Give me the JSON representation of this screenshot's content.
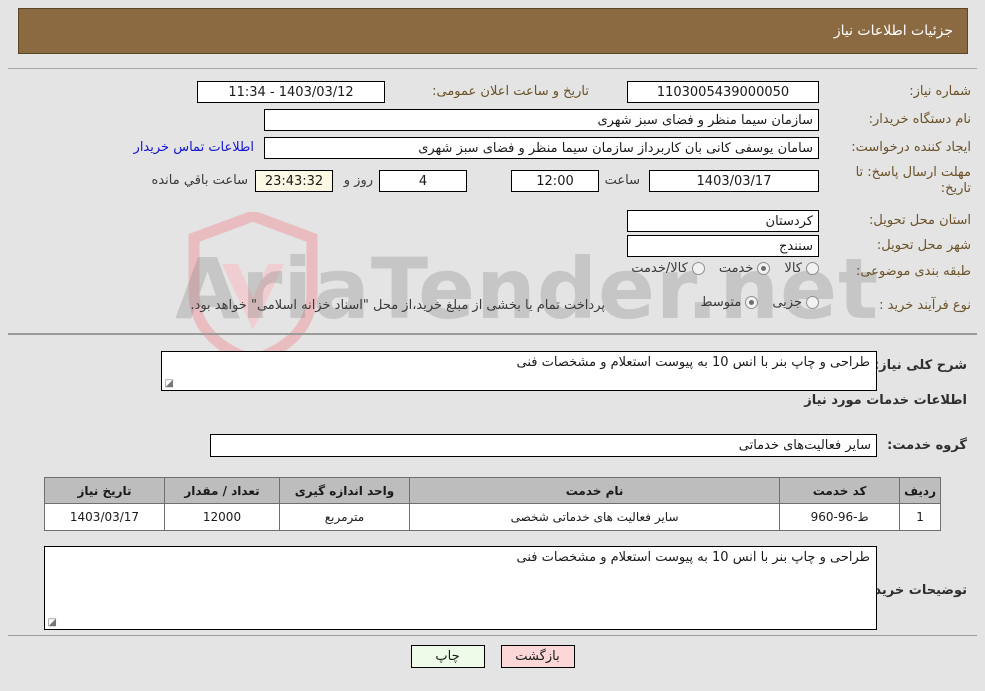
{
  "header": {
    "title": "جزئیات اطلاعات نیاز"
  },
  "watermark": {
    "text": "AriaTender.net",
    "shield_color": "#e8b7bb"
  },
  "form": {
    "need_number_label": "شماره نیاز:",
    "need_number_value": "1103005439000050",
    "announce_datetime_label": "تاریخ و ساعت اعلان عمومی:",
    "announce_datetime_value": "1403/03/12 - 11:34",
    "buyer_org_label": "نام دستگاه خریدار:",
    "buyer_org_value": "سازمان سیما  منظر و فضای سبز شهری",
    "requester_label": "ایجاد کننده درخواست:",
    "requester_value": "سامان یوسفی کانی بان کاربرداز سازمان سیما  منظر و فضای سبز شهری",
    "contact_link": "اطلاعات تماس خریدار",
    "deadline_label": "مهلت ارسال پاسخ: تا تاریخ:",
    "deadline_date": "1403/03/17",
    "deadline_hour_label": "ساعت",
    "deadline_hour_value": "12:00",
    "remaining_days": "4",
    "remaining_days_label": "روز و",
    "remaining_time": "23:43:32",
    "remaining_time_label": "ساعت باقي مانده",
    "province_label": "استان محل تحویل:",
    "province_value": "کردستان",
    "city_label": "شهر محل تحویل:",
    "city_value": "سنندج",
    "classification_label": "طبقه بندی موضوعی:",
    "classification_options": [
      {
        "label": "کالا",
        "selected": false
      },
      {
        "label": "خدمت",
        "selected": true
      },
      {
        "label": "کالا/خدمت",
        "selected": false
      }
    ],
    "process_label": "نوع فرآیند خرید :",
    "process_options": [
      {
        "label": "جزیی",
        "selected": false
      },
      {
        "label": "متوسط",
        "selected": true
      }
    ],
    "treasury_note": "پرداخت تمام یا بخشی از مبلغ خرید،از محل \"اسناد خزانه اسلامی\" خواهد بود."
  },
  "body": {
    "summary_label": "شرح کلی نیاز:",
    "summary_value": "طراحی و چاپ بنر با انس 10 به پیوست استعلام و مشخصات فنی",
    "services_section_title": "اطلاعات خدمات مورد نیاز",
    "service_group_label": "گروه خدمت:",
    "service_group_value": "سایر فعالیت‌های خدماتی",
    "buyer_notes_label": "توضیحات خریدار:",
    "buyer_notes_value": "طراحی و چاپ بنر با انس 10 به پیوست استعلام و مشخصات فنی"
  },
  "table": {
    "columns": [
      "ردیف",
      "کد خدمت",
      "نام خدمت",
      "واحد اندازه گیری",
      "تعداد / مقدار",
      "تاریخ نیاز"
    ],
    "rows": [
      {
        "row_no": "1",
        "service_code": "ط-96-960",
        "service_name": "سایر فعالیت های خدماتی شخصی",
        "unit": "مترمربع",
        "quantity": "12000",
        "need_date": "1403/03/17"
      }
    ]
  },
  "footer": {
    "print_label": "چاپ",
    "back_label": "بازگشت"
  }
}
